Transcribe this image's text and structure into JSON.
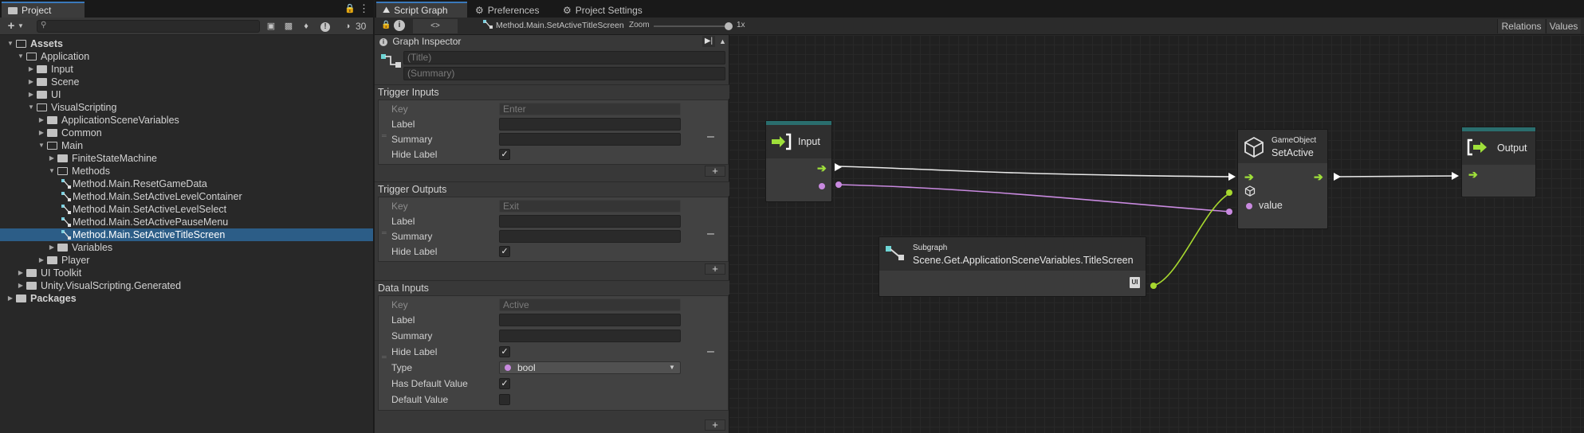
{
  "project": {
    "tab_label": "Project",
    "hidden_count": "30",
    "tree": [
      {
        "label": "Assets",
        "depth": 0,
        "expanded": true,
        "bold": true
      },
      {
        "label": "Application",
        "depth": 1,
        "expanded": true
      },
      {
        "label": "Input",
        "depth": 2,
        "expanded": false
      },
      {
        "label": "Scene",
        "depth": 2,
        "expanded": false
      },
      {
        "label": "UI",
        "depth": 2,
        "expanded": false
      },
      {
        "label": "VisualScripting",
        "depth": 2,
        "expanded": true
      },
      {
        "label": "ApplicationSceneVariables",
        "depth": 3,
        "expanded": false
      },
      {
        "label": "Common",
        "depth": 3,
        "expanded": false
      },
      {
        "label": "Main",
        "depth": 3,
        "expanded": true
      },
      {
        "label": "FiniteStateMachine",
        "depth": 4,
        "expanded": false
      },
      {
        "label": "Methods",
        "depth": 4,
        "expanded": true
      },
      {
        "label": "Method.Main.ResetGameData",
        "depth": 5,
        "asset": true
      },
      {
        "label": "Method.Main.SetActiveLevelContainer",
        "depth": 5,
        "asset": true
      },
      {
        "label": "Method.Main.SetActiveLevelSelect",
        "depth": 5,
        "asset": true
      },
      {
        "label": "Method.Main.SetActivePauseMenu",
        "depth": 5,
        "asset": true
      },
      {
        "label": "Method.Main.SetActiveTitleScreen",
        "depth": 5,
        "asset": true,
        "selected": true
      },
      {
        "label": "Variables",
        "depth": 4,
        "expanded": false
      },
      {
        "label": "Player",
        "depth": 3,
        "expanded": false
      },
      {
        "label": "UI Toolkit",
        "depth": 1,
        "expanded": false
      },
      {
        "label": "Unity.VisualScripting.Generated",
        "depth": 1,
        "expanded": false
      },
      {
        "label": "Packages",
        "depth": 0,
        "expanded": false,
        "bold": true
      }
    ]
  },
  "tabs": {
    "script_graph": "Script Graph",
    "preferences": "Preferences",
    "project_settings": "Project Settings"
  },
  "graph_toolbar": {
    "breadcrumb": "Method.Main.SetActiveTitleScreen",
    "zoom_label": "Zoom",
    "zoom_value": "1x",
    "relations": "Relations",
    "values": "Values",
    "code_btn": "<>"
  },
  "inspector": {
    "title": "Graph Inspector",
    "title_placeholder": "(Title)",
    "summary_placeholder": "(Summary)",
    "trigger_inputs": {
      "header": "Trigger Inputs",
      "key_label": "Key",
      "key_value": "Enter",
      "label_label": "Label",
      "summary_label": "Summary",
      "hide_label": "Hide Label"
    },
    "trigger_outputs": {
      "header": "Trigger Outputs",
      "key_label": "Key",
      "key_value": "Exit",
      "label_label": "Label",
      "summary_label": "Summary",
      "hide_label": "Hide Label"
    },
    "data_inputs": {
      "header": "Data Inputs",
      "key_label": "Key",
      "key_value": "Active",
      "label_label": "Label",
      "summary_label": "Summary",
      "hide_label": "Hide Label",
      "type_label": "Type",
      "type_value": "bool",
      "has_default_label": "Has Default Value",
      "default_label": "Default Value"
    }
  },
  "nodes": {
    "input": {
      "title": "Input"
    },
    "subgraph": {
      "sub": "Subgraph",
      "title": "Scene.Get.ApplicationSceneVariables.TitleScreen",
      "port_badge": "UI"
    },
    "setactive": {
      "sub": "GameObject",
      "title": "SetActive",
      "port_label": "value"
    },
    "output": {
      "title": "Output"
    }
  },
  "colors": {
    "selection": "#2c5d87",
    "flow_arrow": "#9fe03a",
    "bool_port": "#c98ae0",
    "object_port": "#a7d82f",
    "node_accent": "#2a6e6e"
  }
}
